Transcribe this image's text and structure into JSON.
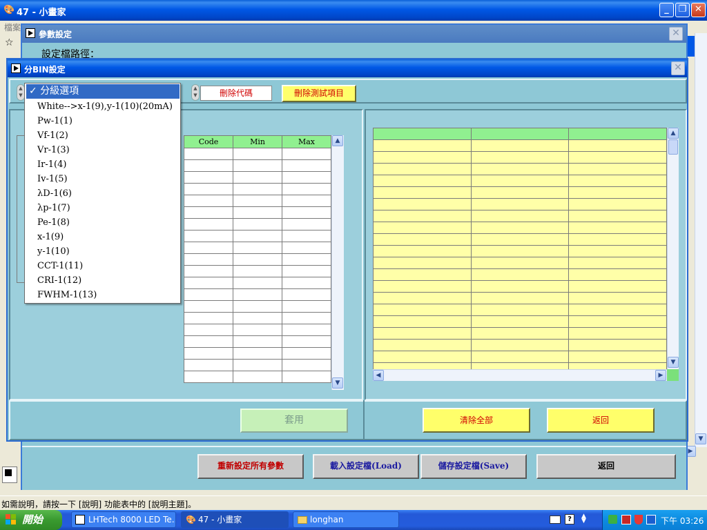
{
  "main_window": {
    "title": "47 - 小畫家",
    "menu_first": "檔案",
    "status_text": "如需說明，請按一下 [說明] 功能表中的 [說明主題]。"
  },
  "param_window": {
    "title": "參數設定",
    "path_label": "設定檔路徑：",
    "buttons": {
      "reset": "重新設定所有參數",
      "load": "載入設定檔(Load)",
      "save": "儲存設定檔(Save)",
      "back": "返回"
    }
  },
  "bin_window": {
    "title": "分BIN設定",
    "delete_code": "刪除代碼",
    "delete_test": "刪除測試項目",
    "apply": "套用",
    "clear_all": "清除全部",
    "back": "返回",
    "dropdown": {
      "selected": "分級選項",
      "check": "✓",
      "items": [
        "White-->x-1(9),y-1(10)(20mA)",
        "Pw-1(1)",
        "Vf-1(2)",
        "Vr-1(3)",
        "Ir-1(4)",
        "Iv-1(5)",
        "λD-1(6)",
        "λp-1(7)",
        "Pe-1(8)",
        "x-1(9)",
        "y-1(10)",
        "CCT-1(11)",
        "CRI-1(12)",
        "FWHM-1(13)"
      ]
    },
    "code_table": {
      "headers": [
        "Code",
        "Min",
        "Max"
      ]
    }
  },
  "taskbar": {
    "start": "開始",
    "items": [
      "LHTech 8000 LED Te...",
      "47 - 小畫家",
      "longhan"
    ],
    "clock": "下午 03:26"
  },
  "colors": {
    "xp_blue": "#0058e6",
    "teal_panel": "#8ec8d6",
    "yellow_cells": "#ffffa8",
    "green_header": "#90f090",
    "button_yellow": "#ffff6a",
    "button_text_red": "#d00000"
  }
}
